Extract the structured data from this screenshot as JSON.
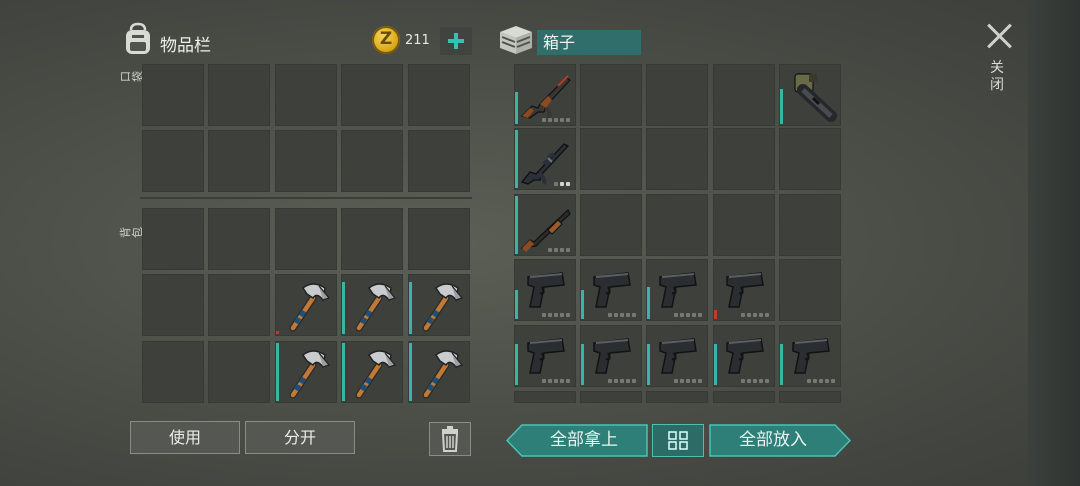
{
  "inventory": {
    "title": "物品栏",
    "pocket_label": "口袋",
    "backpack_label": "背包"
  },
  "currency": {
    "icon": "coin-icon",
    "amount": "211",
    "symbol": "Z"
  },
  "box": {
    "title": "箱子"
  },
  "close_label": "关闭",
  "buttons": {
    "use": "使用",
    "split": "分开",
    "take_all": "全部拿上",
    "put_all": "全部放入"
  },
  "colors": {
    "accent": "#35c2b4",
    "durability": "#38b4a8",
    "durability_low": "#c23a2e",
    "box_title_bg": "#2f6e6a"
  },
  "backpack_items": [
    {
      "slot": "row2-col3",
      "icon": "hatchet-icon",
      "durability": 0.05,
      "durability_color": "low"
    },
    {
      "slot": "row2-col4",
      "icon": "hatchet-icon",
      "durability": 0.9
    },
    {
      "slot": "row2-col5",
      "icon": "hatchet-icon",
      "durability": 0.9
    },
    {
      "slot": "row3-col3",
      "icon": "hatchet-icon",
      "durability": 1.0
    },
    {
      "slot": "row3-col4",
      "icon": "hatchet-icon",
      "durability": 1.0
    },
    {
      "slot": "row3-col5",
      "icon": "hatchet-icon",
      "durability": 1.0
    }
  ],
  "box_items": [
    {
      "slot": "row1-col1",
      "icon": "assault-rifle-ak-icon",
      "durability": 0.55,
      "upgrade_slots": 5,
      "upgrades_filled": 0
    },
    {
      "slot": "row1-col5",
      "icon": "minigun-icon",
      "durability": 0.6
    },
    {
      "slot": "row2-col1",
      "icon": "assault-rifle-m16-icon",
      "durability": 1.0,
      "upgrade_slots": 3,
      "upgrades_filled": 2
    },
    {
      "slot": "row3-col1",
      "icon": "shotgun-icon",
      "durability": 1.0,
      "upgrade_slots": 4,
      "upgrades_filled": 0
    },
    {
      "slot": "row4-col1",
      "icon": "pistol-icon",
      "durability": 0.5,
      "upgrade_slots": 5,
      "upgrades_filled": 0
    },
    {
      "slot": "row4-col2",
      "icon": "pistol-icon",
      "durability": 0.5,
      "upgrade_slots": 5,
      "upgrades_filled": 0
    },
    {
      "slot": "row4-col3",
      "icon": "pistol-icon",
      "durability": 0.55,
      "upgrade_slots": 5,
      "upgrades_filled": 0
    },
    {
      "slot": "row4-col4",
      "icon": "pistol-icon",
      "durability": 0.15,
      "durability_color": "low",
      "upgrade_slots": 5,
      "upgrades_filled": 0
    },
    {
      "slot": "row5-col1",
      "icon": "pistol-icon",
      "durability": 0.7,
      "upgrade_slots": 5,
      "upgrades_filled": 0
    },
    {
      "slot": "row5-col2",
      "icon": "pistol-icon",
      "durability": 0.7,
      "upgrade_slots": 5,
      "upgrades_filled": 0
    },
    {
      "slot": "row5-col3",
      "icon": "pistol-icon",
      "durability": 0.7,
      "upgrade_slots": 5,
      "upgrades_filled": 0
    },
    {
      "slot": "row5-col4",
      "icon": "pistol-icon",
      "durability": 0.7,
      "upgrade_slots": 5,
      "upgrades_filled": 0
    },
    {
      "slot": "row5-col5",
      "icon": "pistol-icon",
      "durability": 0.7,
      "upgrade_slots": 5,
      "upgrades_filled": 0
    }
  ]
}
